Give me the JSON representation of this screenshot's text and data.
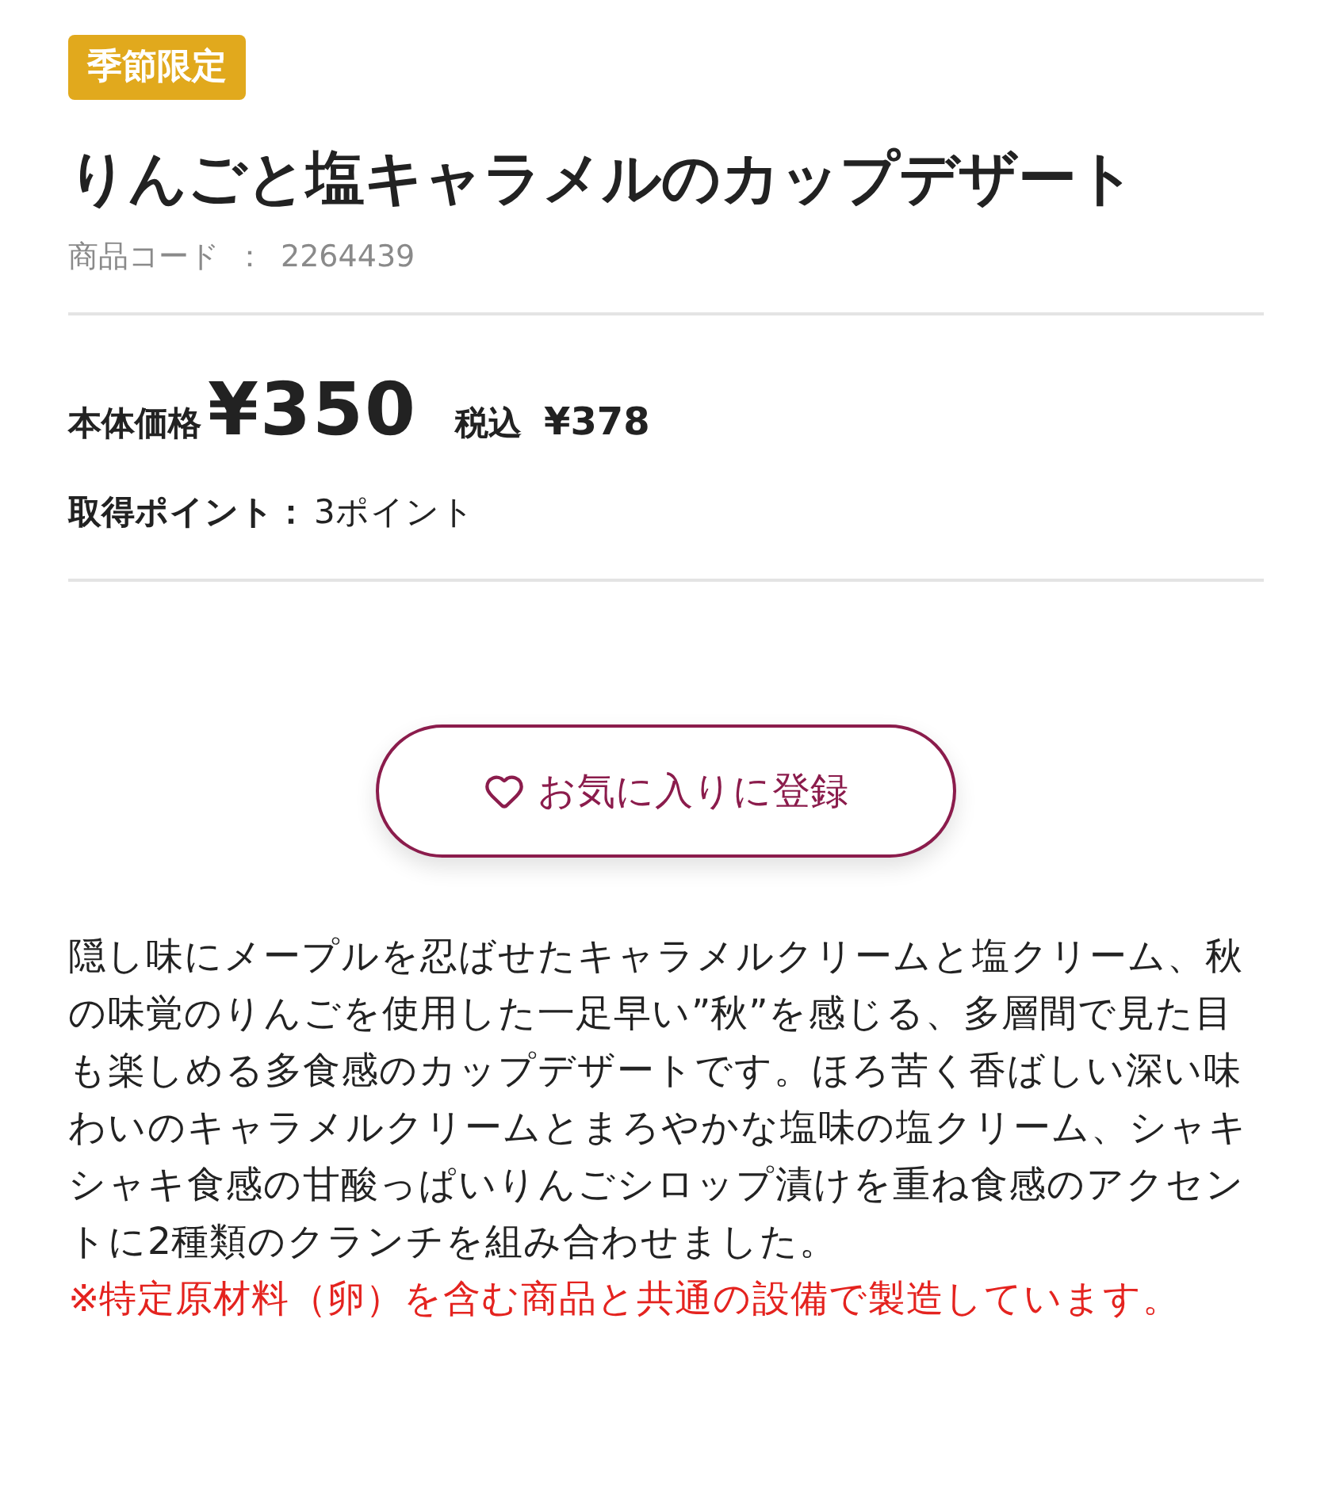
{
  "badge": "季節限定",
  "title": "りんごと塩キャラメルのカップデザート",
  "product_code": {
    "label": "商品コード",
    "separator": "：",
    "value": "2264439"
  },
  "price": {
    "label": "本体価格",
    "value": "¥350",
    "tax_label": "税込",
    "tax_value": "¥378"
  },
  "points": {
    "label": "取得ポイント：",
    "value": "3ポイント"
  },
  "favorite_button": {
    "label": "お気に入りに登録"
  },
  "description": "隠し味にメープルを忍ばせたキャラメルクリームと塩クリーム、秋の味覚のりんごを使用した一足早い”秋”を感じる、多層間で見た目も楽しめる多食感のカップデザートです。ほろ苦く香ばしい深い味わいのキャラメルクリームとまろやかな塩味の塩クリーム、シャキシャキ食感の甘酸っぱいりんごシロップ漬けを重ね食感のアクセントに2種類のクランチを組み合わせました。",
  "notice": "※特定原材料（卵）を含む商品と共通の設備で製造しています。"
}
